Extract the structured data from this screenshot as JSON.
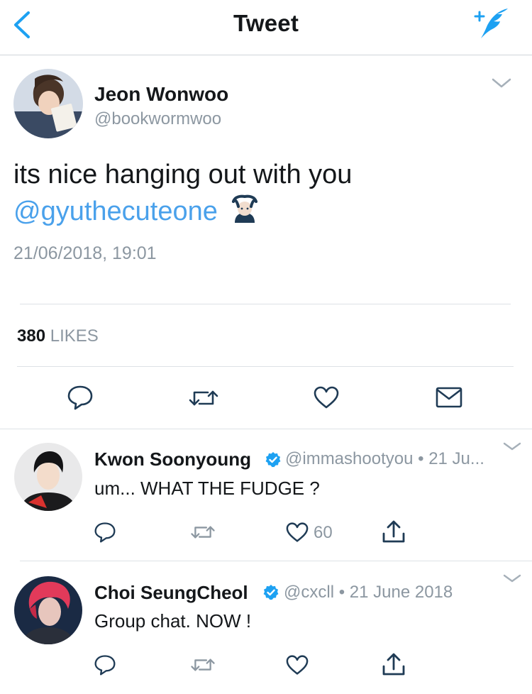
{
  "header": {
    "title": "Tweet"
  },
  "tweet": {
    "author_name": "Jeon Wonwoo",
    "author_handle": "@bookwormwoo",
    "text": "its nice hanging out with you",
    "mention": "@gyuthecuteone",
    "timestamp": "21/06/2018, 19:01",
    "likes_count": "380",
    "likes_label": "LIKES"
  },
  "replies": [
    {
      "name": "Kwon Soonyoung",
      "handle": "@immashootyou",
      "date": "21 Ju...",
      "text": "um... WHAT THE FUDGE ?",
      "like_count": "60"
    },
    {
      "name": "Choi SeungCheol",
      "handle": "@cxcll",
      "date": "21 June 2018",
      "text": "Group chat. NOW !"
    }
  ],
  "colors": {
    "accent": "#4aa1eb",
    "secondary_text": "#8c97a1",
    "icon_gray": "#8c97a1",
    "icon_dark": "#1f3b55",
    "verified": "#1da1f2"
  },
  "icons": [
    "back-icon",
    "compose-icon",
    "chevron-down-icon",
    "reply-icon",
    "retweet-icon",
    "like-icon",
    "message-icon",
    "share-icon",
    "verified-icon",
    "emoji-icon"
  ]
}
